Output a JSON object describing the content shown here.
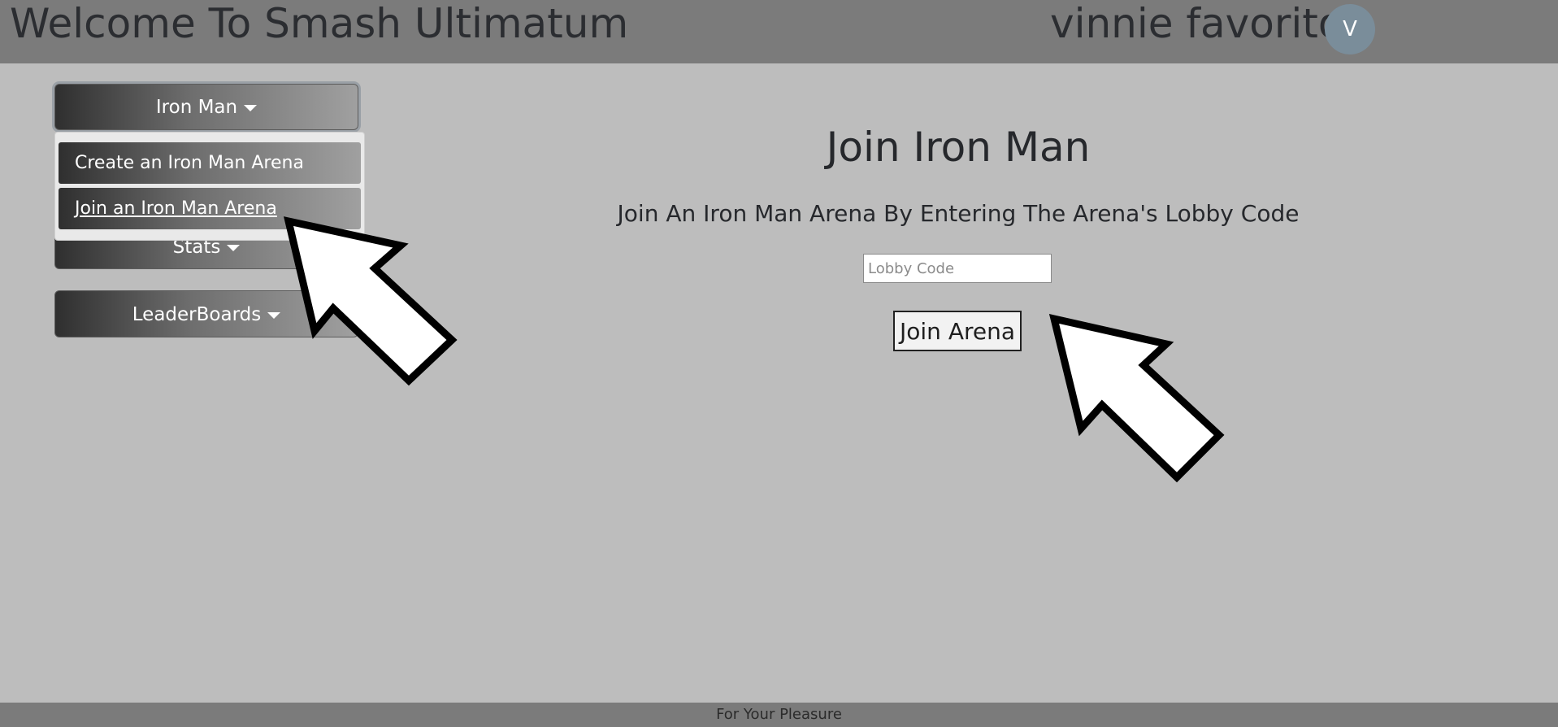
{
  "header": {
    "title": "Welcome To Smash Ultimatum",
    "username": "vinnie favorito",
    "avatar_initial": "V",
    "avatar_color": "#7a8d9a"
  },
  "sidebar": {
    "ironman_label": "Iron Man",
    "ironman_menu": {
      "create_label": "Create an Iron Man Arena",
      "join_label": "Join an Iron Man Arena"
    },
    "stats_label": "Stats",
    "leaderboards_label": "LeaderBoards"
  },
  "main": {
    "heading": "Join Iron Man",
    "subheading": "Join An Iron Man Arena By Entering The Arena's Lobby Code",
    "lobby_input": {
      "placeholder": "Lobby Code",
      "value": ""
    },
    "join_button_label": "Join Arena"
  },
  "footer": {
    "text": "For Your Pleasure"
  },
  "colors": {
    "background": "#bdbdbd",
    "header_bg": "#7b7b7b",
    "text": "#26282c"
  },
  "annotations": [
    "arrow-pointer-icon",
    "arrow-pointer-icon"
  ]
}
